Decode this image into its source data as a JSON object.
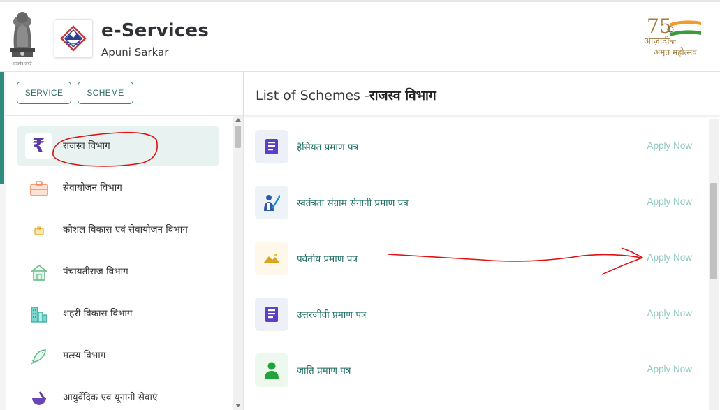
{
  "header": {
    "title": "e-Services",
    "subtitle": "Apuni Sarkar",
    "emblem_caption": "सत्यमेव जयते",
    "azadi_line1": "आज़ादी",
    "azadi_line1_small": "का",
    "azadi_line2": "अमृत महोत्सव",
    "azadi_number": "75"
  },
  "tabs": {
    "service": "SERVICE",
    "scheme": "SCHEME"
  },
  "departments": [
    {
      "label": "राजस्व विभाग",
      "icon": "rupee-icon",
      "active": true
    },
    {
      "label": "सेवायोजन विभाग",
      "icon": "briefcase-icon"
    },
    {
      "label": "कौशल विकास एवं सेवायोजन विभाग",
      "icon": "small-briefcase-icon"
    },
    {
      "label": "पंचायतीराज विभाग",
      "icon": "house-icon"
    },
    {
      "label": "शहरी विकास विभाग",
      "icon": "buildings-icon"
    },
    {
      "label": "मत्स्य विभाग",
      "icon": "fish-icon"
    },
    {
      "label": "आयुर्वेदिक एवं यूनानी सेवाएं",
      "icon": "mortar-pestle-icon"
    }
  ],
  "schemes_header": {
    "prefix": "List of Schemes -",
    "department": "राजस्व विभाग"
  },
  "schemes": [
    {
      "label": "हैसियत प्रमाण पत्र",
      "apply": "Apply Now",
      "icon": "certificate-icon"
    },
    {
      "label": "स्वतंत्रता संग्राम सेनानी प्रमाण पत्र",
      "apply": "Apply Now",
      "icon": "freedom-fighter-icon"
    },
    {
      "label": "पर्वतीय प्रमाण पत्र",
      "apply": "Apply Now",
      "icon": "mountain-icon"
    },
    {
      "label": "उत्तरजीवी प्रमाण पत्र",
      "apply": "Apply Now",
      "icon": "certificate-icon"
    },
    {
      "label": "जाति प्रमाण पत्र",
      "apply": "Apply Now",
      "icon": "person-icon"
    }
  ],
  "colors": {
    "accent": "#2f8a7c",
    "scheme_text": "#1f6e64",
    "apply_text": "#8fc9c0",
    "annotation": "#e01010"
  }
}
